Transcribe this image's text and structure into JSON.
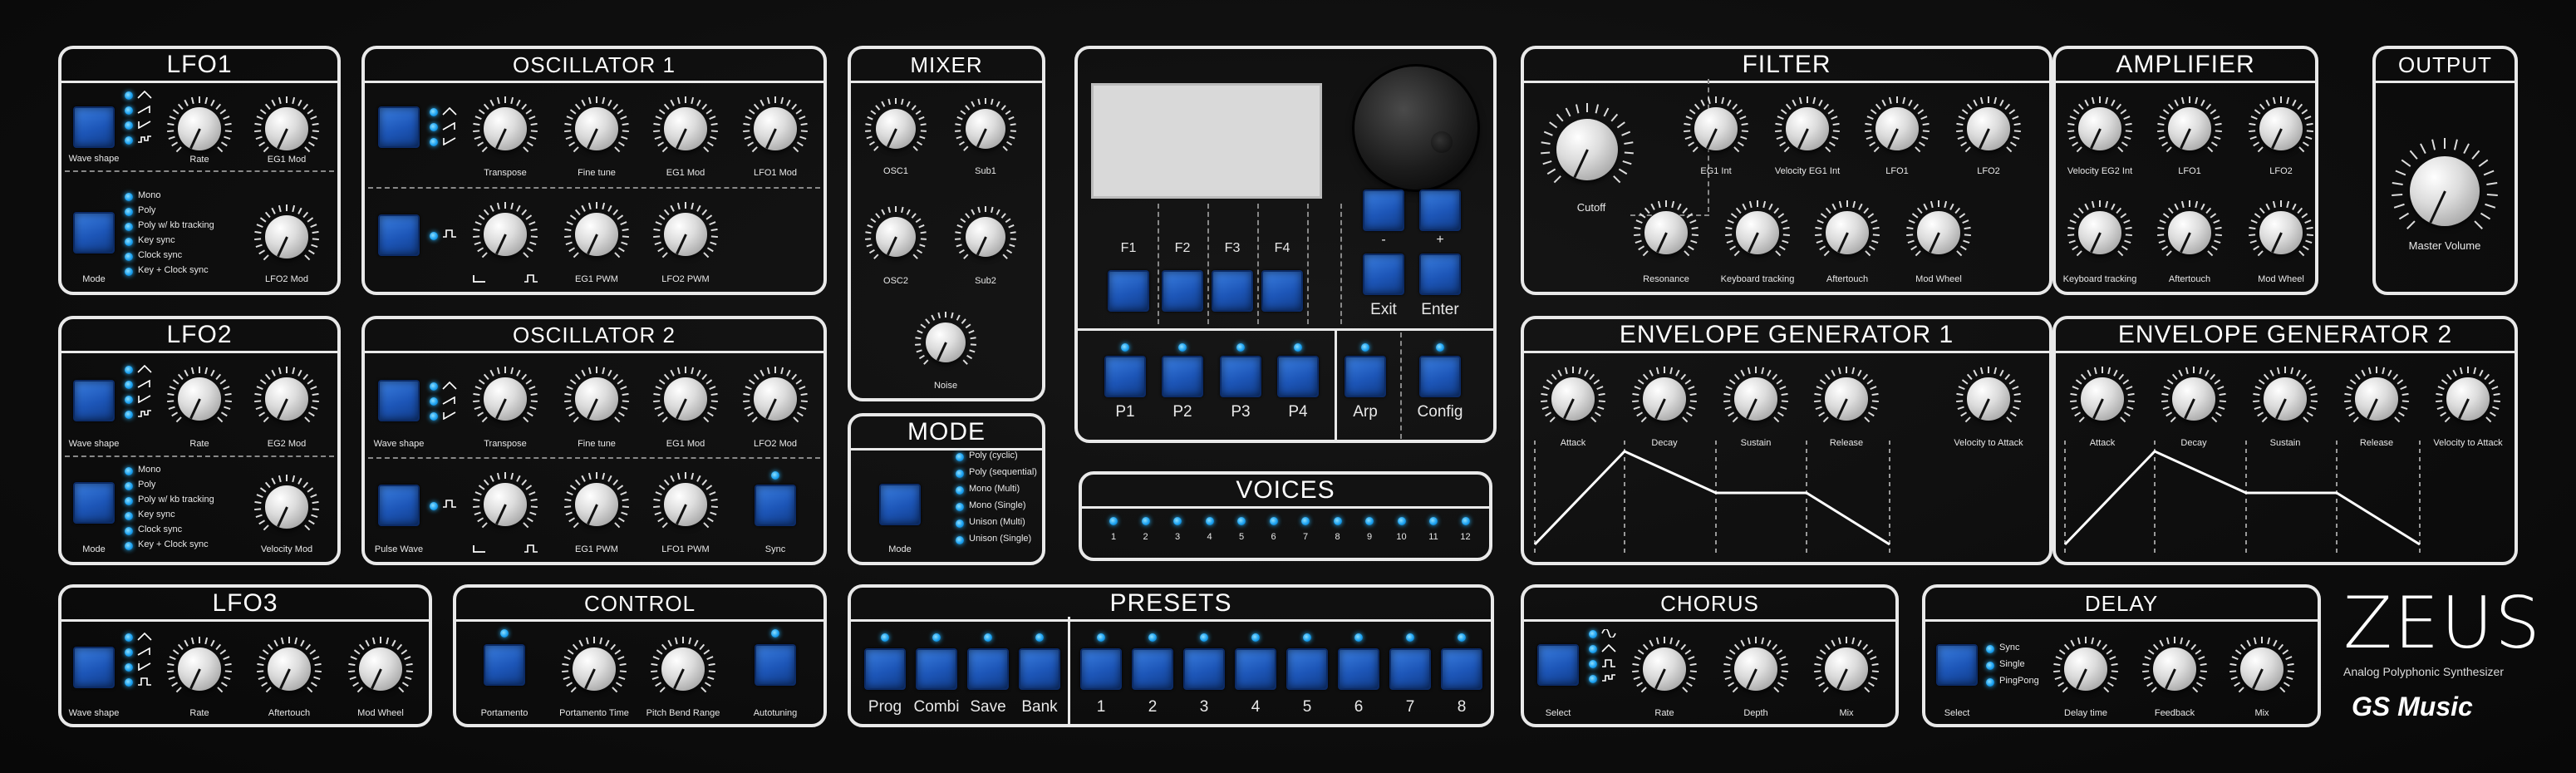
{
  "brand": {
    "name": "ZEUS",
    "tagline": "Analog Polyphonic Synthesizer",
    "maker": "GS Music"
  },
  "lfo1": {
    "title": "LFO1",
    "wave_label": "Wave shape",
    "mode_label": "Mode",
    "modes": [
      "Mono",
      "Poly",
      "Poly w/ kb tracking",
      "Key sync",
      "Clock sync",
      "Key + Clock sync"
    ],
    "knobs": [
      "Rate",
      "EG1 Mod",
      "LFO2 Mod"
    ]
  },
  "lfo2": {
    "title": "LFO2",
    "wave_label": "Wave shape",
    "mode_label": "Mode",
    "modes": [
      "Mono",
      "Poly",
      "Poly w/ kb tracking",
      "Key sync",
      "Clock sync",
      "Key + Clock sync"
    ],
    "knobs": [
      "Rate",
      "EG2 Mod",
      "Velocity Mod"
    ]
  },
  "lfo3": {
    "title": "LFO3",
    "wave_label": "Wave shape",
    "knobs": [
      "Rate",
      "Aftertouch",
      "Mod Wheel"
    ]
  },
  "osc1": {
    "title": "OSCILLATOR 1",
    "knobs": [
      "Transpose",
      "Fine tune",
      "EG1 Mod",
      "LFO1 Mod",
      "EG1 PWM",
      "LFO2 PWM"
    ]
  },
  "osc2": {
    "title": "OSCILLATOR 2",
    "wave_label": "Wave shape",
    "pulse_label": "Pulse Wave",
    "sync_label": "Sync",
    "knobs": [
      "Transpose",
      "Fine tune",
      "EG1 Mod",
      "LFO2 Mod",
      "EG1 PWM",
      "LFO1 PWM"
    ]
  },
  "mixer": {
    "title": "MIXER",
    "knobs": [
      "OSC1",
      "Sub1",
      "OSC2",
      "Sub2",
      "Noise"
    ]
  },
  "mode": {
    "title": "MODE",
    "button_label": "Mode",
    "options": [
      "Poly (cyclic)",
      "Poly (sequential)",
      "Mono (Multi)",
      "Mono (Single)",
      "Unison (Multi)",
      "Unison (Single)"
    ]
  },
  "display": {
    "fkeys": [
      "F1",
      "F2",
      "F3",
      "F4"
    ],
    "minus": "-",
    "plus": "+",
    "exit": "Exit",
    "enter": "Enter",
    "perf": [
      "P1",
      "P2",
      "P3",
      "P4"
    ],
    "arp": "Arp",
    "config": "Config"
  },
  "voices": {
    "title": "VOICES",
    "numbers": [
      "1",
      "2",
      "3",
      "4",
      "5",
      "6",
      "7",
      "8",
      "9",
      "10",
      "11",
      "12"
    ]
  },
  "control": {
    "title": "CONTROL",
    "items": [
      "Portamento",
      "Portamento Time",
      "Pitch Bend Range",
      "Autotuning"
    ]
  },
  "presets": {
    "title": "PRESETS",
    "banks": [
      "Prog",
      "Combi",
      "Save",
      "Bank"
    ],
    "slots": [
      "1",
      "2",
      "3",
      "4",
      "5",
      "6",
      "7",
      "8"
    ]
  },
  "filter": {
    "title": "FILTER",
    "knobs": [
      "Cutoff",
      "EG1 Int",
      "Velocity EG1 Int",
      "LFO1",
      "LFO2",
      "Resonance",
      "Keyboard tracking",
      "Aftertouch",
      "Mod Wheel"
    ]
  },
  "amplifier": {
    "title": "AMPLIFIER",
    "knobs": [
      "Velocity EG2 Int",
      "LFO1",
      "LFO2",
      "Keyboard tracking",
      "Aftertouch",
      "Mod Wheel"
    ]
  },
  "output": {
    "title": "OUTPUT",
    "knob": "Master Volume"
  },
  "eg1": {
    "title": "ENVELOPE GENERATOR 1",
    "knobs": [
      "Attack",
      "Decay",
      "Sustain",
      "Release",
      "Velocity to Attack"
    ]
  },
  "eg2": {
    "title": "ENVELOPE GENERATOR 2",
    "knobs": [
      "Attack",
      "Decay",
      "Sustain",
      "Release",
      "Velocity to Attack"
    ]
  },
  "chorus": {
    "title": "CHORUS",
    "select": "Select",
    "knobs": [
      "Rate",
      "Depth",
      "Mix"
    ]
  },
  "delay": {
    "title": "DELAY",
    "select": "Select",
    "modes": [
      "Sync",
      "Single",
      "PingPong"
    ],
    "knobs": [
      "Delay time",
      "Feedback",
      "Mix"
    ]
  },
  "theme": {
    "accent": "#2f6fd8",
    "led": "#29b6ff",
    "panel_line": "#e9e9e9",
    "background": "#0b0b0b"
  }
}
